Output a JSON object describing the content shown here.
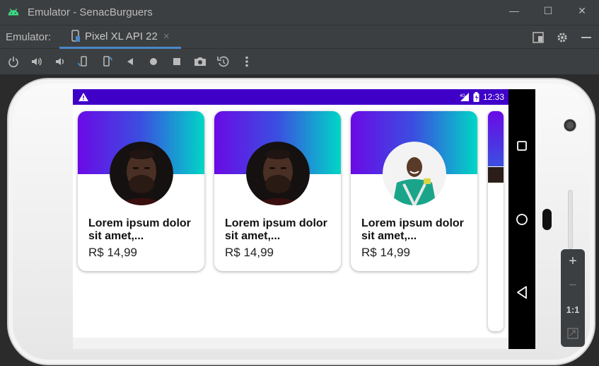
{
  "window": {
    "title": "Emulator - SenacBurguers",
    "controls": [
      "minimize-icon",
      "maximize-icon",
      "close-icon"
    ]
  },
  "tabbar": {
    "label": "Emulator:",
    "tab": {
      "title": "Pixel XL API 22",
      "close": "×"
    },
    "actions": [
      "window-mode-icon",
      "gear-icon",
      "minimize-panel-icon"
    ]
  },
  "toolbar": {
    "icons": [
      "power-icon",
      "volume-up-icon",
      "volume-down-icon",
      "rotate-left-icon",
      "rotate-right-icon",
      "back-icon",
      "home-icon",
      "overview-icon",
      "camera-icon",
      "snapshot-icon",
      "more-icon"
    ]
  },
  "device": {
    "status_bar": {
      "time": "12:33",
      "network": "4G"
    },
    "cards": [
      {
        "name": "Lorem ipsum dolor sit amet,...",
        "price": "R$ 14,99"
      },
      {
        "name": "Lorem ipsum dolor sit amet,...",
        "price": "R$ 14,99"
      },
      {
        "name": "Lorem ipsum dolor sit amet,...",
        "price": "R$ 14,99"
      }
    ]
  },
  "zoom_panel": {
    "zoom_in": "+",
    "zoom_out": "−",
    "ratio": "1:1"
  },
  "colors": {
    "status_bar": "#3f00c8",
    "gradient_start": "#6a0ae6",
    "gradient_end": "#00d6c6",
    "accent_tab": "#4a88c7"
  }
}
